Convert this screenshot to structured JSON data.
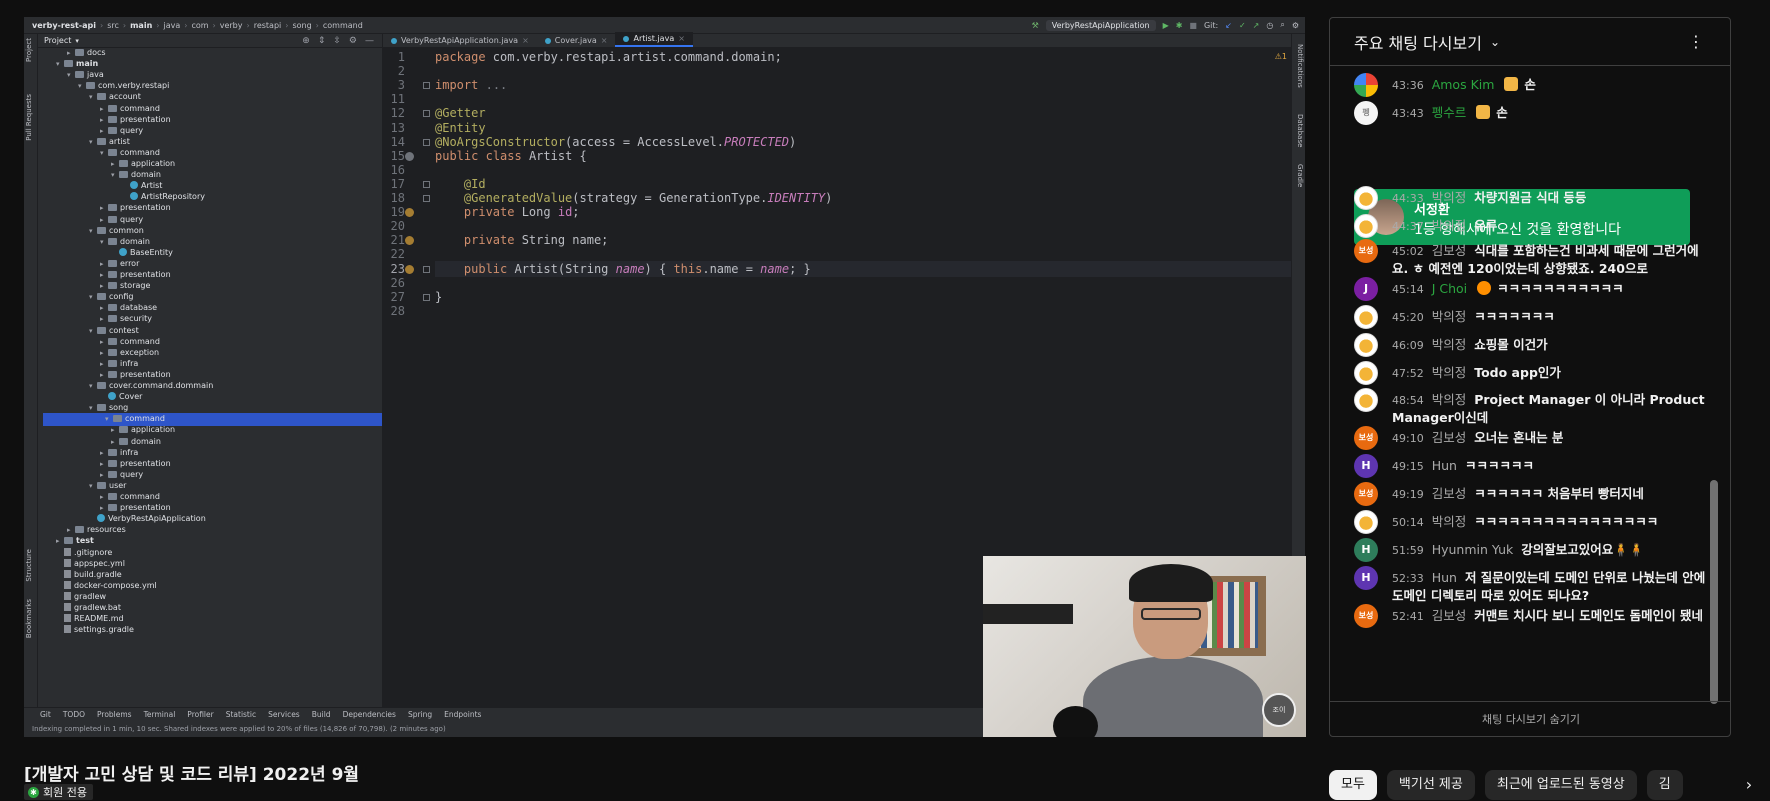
{
  "ide": {
    "breadcrumbs": [
      "verby-rest-api",
      "src",
      "main",
      "java",
      "com",
      "verby",
      "restapi",
      "song",
      "command"
    ],
    "run_config": "VerbyRestApiApplication",
    "git_label": "Git:",
    "project_header": "Project",
    "left_tabs": [
      "Project",
      "Pull Requests",
      "Structure",
      "Bookmarks"
    ],
    "right_tabs": [
      "Notifications",
      "Database",
      "Gradle"
    ],
    "tabs": [
      {
        "label": "VerbyRestApiApplication.java",
        "active": false
      },
      {
        "label": "Cover.java",
        "active": false
      },
      {
        "label": "Artist.java",
        "active": true
      }
    ],
    "tree": [
      {
        "label": "docs",
        "depth": 3,
        "kind": "folder",
        "arrow": "▸"
      },
      {
        "label": "main",
        "depth": 2,
        "kind": "folder",
        "arrow": "▾",
        "bold": true
      },
      {
        "label": "java",
        "depth": 3,
        "kind": "folder",
        "arrow": "▾"
      },
      {
        "label": "com.verby.restapi",
        "depth": 4,
        "kind": "folder",
        "arrow": "▾"
      },
      {
        "label": "account",
        "depth": 5,
        "kind": "folder",
        "arrow": "▾"
      },
      {
        "label": "command",
        "depth": 6,
        "kind": "folder",
        "arrow": "▸"
      },
      {
        "label": "presentation",
        "depth": 6,
        "kind": "folder",
        "arrow": "▸"
      },
      {
        "label": "query",
        "depth": 6,
        "kind": "folder",
        "arrow": "▸"
      },
      {
        "label": "artist",
        "depth": 5,
        "kind": "folder",
        "arrow": "▾"
      },
      {
        "label": "command",
        "depth": 6,
        "kind": "folder",
        "arrow": "▾"
      },
      {
        "label": "application",
        "depth": 7,
        "kind": "folder",
        "arrow": "▸"
      },
      {
        "label": "domain",
        "depth": 7,
        "kind": "folder",
        "arrow": "▾"
      },
      {
        "label": "Artist",
        "depth": 8,
        "kind": "class",
        "arrow": ""
      },
      {
        "label": "ArtistRepository",
        "depth": 8,
        "kind": "class",
        "arrow": ""
      },
      {
        "label": "presentation",
        "depth": 6,
        "kind": "folder",
        "arrow": "▸"
      },
      {
        "label": "query",
        "depth": 6,
        "kind": "folder",
        "arrow": "▸"
      },
      {
        "label": "common",
        "depth": 5,
        "kind": "folder",
        "arrow": "▾"
      },
      {
        "label": "domain",
        "depth": 6,
        "kind": "folder",
        "arrow": "▾"
      },
      {
        "label": "BaseEntity",
        "depth": 7,
        "kind": "class",
        "arrow": ""
      },
      {
        "label": "error",
        "depth": 6,
        "kind": "folder",
        "arrow": "▸"
      },
      {
        "label": "presentation",
        "depth": 6,
        "kind": "folder",
        "arrow": "▸"
      },
      {
        "label": "storage",
        "depth": 6,
        "kind": "folder",
        "arrow": "▸"
      },
      {
        "label": "config",
        "depth": 5,
        "kind": "folder",
        "arrow": "▾"
      },
      {
        "label": "database",
        "depth": 6,
        "kind": "folder",
        "arrow": "▸"
      },
      {
        "label": "security",
        "depth": 6,
        "kind": "folder",
        "arrow": "▸"
      },
      {
        "label": "contest",
        "depth": 5,
        "kind": "folder",
        "arrow": "▾"
      },
      {
        "label": "command",
        "depth": 6,
        "kind": "folder",
        "arrow": "▸"
      },
      {
        "label": "exception",
        "depth": 6,
        "kind": "folder",
        "arrow": "▸"
      },
      {
        "label": "infra",
        "depth": 6,
        "kind": "folder",
        "arrow": "▸"
      },
      {
        "label": "presentation",
        "depth": 6,
        "kind": "folder",
        "arrow": "▸"
      },
      {
        "label": "cover.command.dommain",
        "depth": 5,
        "kind": "folder",
        "arrow": "▾"
      },
      {
        "label": "Cover",
        "depth": 6,
        "kind": "class",
        "arrow": ""
      },
      {
        "label": "song",
        "depth": 5,
        "kind": "folder",
        "arrow": "▾"
      },
      {
        "label": "command",
        "depth": 6,
        "kind": "folder",
        "arrow": "▾",
        "selected": true
      },
      {
        "label": "application",
        "depth": 7,
        "kind": "folder",
        "arrow": "▸"
      },
      {
        "label": "domain",
        "depth": 7,
        "kind": "folder",
        "arrow": "▸"
      },
      {
        "label": "infra",
        "depth": 6,
        "kind": "folder",
        "arrow": "▸"
      },
      {
        "label": "presentation",
        "depth": 6,
        "kind": "folder",
        "arrow": "▸"
      },
      {
        "label": "query",
        "depth": 6,
        "kind": "folder",
        "arrow": "▸"
      },
      {
        "label": "user",
        "depth": 5,
        "kind": "folder",
        "arrow": "▾"
      },
      {
        "label": "command",
        "depth": 6,
        "kind": "folder",
        "arrow": "▸"
      },
      {
        "label": "presentation",
        "depth": 6,
        "kind": "folder",
        "arrow": "▸"
      },
      {
        "label": "VerbyRestApiApplication",
        "depth": 5,
        "kind": "class",
        "arrow": ""
      },
      {
        "label": "resources",
        "depth": 3,
        "kind": "folder",
        "arrow": "▸"
      },
      {
        "label": "test",
        "depth": 2,
        "kind": "folder",
        "arrow": "▸",
        "bold": true
      },
      {
        "label": ".gitignore",
        "depth": 2,
        "kind": "file",
        "arrow": ""
      },
      {
        "label": "appspec.yml",
        "depth": 2,
        "kind": "file",
        "arrow": ""
      },
      {
        "label": "build.gradle",
        "depth": 2,
        "kind": "file",
        "arrow": ""
      },
      {
        "label": "docker-compose.yml",
        "depth": 2,
        "kind": "file",
        "arrow": ""
      },
      {
        "label": "gradlew",
        "depth": 2,
        "kind": "file",
        "arrow": ""
      },
      {
        "label": "gradlew.bat",
        "depth": 2,
        "kind": "file",
        "arrow": ""
      },
      {
        "label": "README.md",
        "depth": 2,
        "kind": "file",
        "arrow": ""
      },
      {
        "label": "settings.gradle",
        "depth": 2,
        "kind": "file",
        "arrow": ""
      }
    ],
    "line_numbers": [
      "1",
      "2",
      "3",
      "11",
      "12",
      "13",
      "14",
      "15",
      "16",
      "17",
      "18",
      "19",
      "20",
      "21",
      "22",
      "23",
      "26",
      "27",
      "28"
    ],
    "code_lines": [
      "package com.verby.restapi.artist.command.domain;",
      "",
      "import ...",
      "",
      "@Getter",
      "@Entity",
      "@NoArgsConstructor(access = AccessLevel.PROTECTED)",
      "public class Artist {",
      "",
      "    @Id",
      "    @GeneratedValue(strategy = GenerationType.IDENTITY)",
      "    private Long id;",
      "",
      "    private String name;",
      "",
      "    public Artist(String name) { this.name = name; }",
      "",
      "}",
      ""
    ],
    "warning_count": "⚠1",
    "bottom_tools": [
      "Git",
      "TODO",
      "Problems",
      "Terminal",
      "Profiler",
      "Statistic",
      "Services",
      "Build",
      "Dependencies",
      "Spring",
      "Endpoints"
    ],
    "status_text": "Indexing completed in 1 min, 10 sec. Shared indexes were applied to 20% of files (14,826 of 70,798). (2 minutes ago)"
  },
  "webcam": {
    "logo_text": "조이"
  },
  "video": {
    "title": "[개발자 고민 상담 및 코드 리뷰] 2022년 9월",
    "members_label": "회원 전용"
  },
  "chat": {
    "title": "주요 채팅 다시보기",
    "footer": "채팅 다시보기 숨기기",
    "welcome": {
      "name": "서정환",
      "text": "1등 항해사에 오신 것을 환영합니다"
    },
    "messages": [
      {
        "time": "43:36",
        "author": "Amos Kim",
        "member": true,
        "badge": "square",
        "text": "손",
        "avatar": "google",
        "avatar_text": ""
      },
      {
        "time": "43:43",
        "author": "펭수르",
        "member": true,
        "badge": "square",
        "text": "손",
        "avatar": "white",
        "avatar_text": "펭"
      },
      {
        "time": "44:33",
        "author": "박의정",
        "member": false,
        "badge": "",
        "text": "차량지원금 식대 등등",
        "avatar": "chicken",
        "avatar_text": ""
      },
      {
        "time": "44:37",
        "author": "박의정",
        "member": false,
        "badge": "",
        "text": "유류",
        "avatar": "chicken",
        "avatar_text": ""
      },
      {
        "time": "45:02",
        "author": "김보성",
        "member": false,
        "badge": "",
        "text": "식대를 포함하는건 비과세 때문에 그런거에요. ㅎ 예전엔 120이었는데 상향됐죠. 240으로",
        "avatar": "orange",
        "avatar_text": "보성"
      },
      {
        "time": "45:14",
        "author": "J Choi",
        "member": true,
        "badge": "round",
        "text": "ㅋㅋㅋㅋㅋㅋㅋㅋㅋㅋㅋ",
        "avatar": "purple2",
        "avatar_text": "J"
      },
      {
        "time": "45:20",
        "author": "박의정",
        "member": false,
        "badge": "",
        "text": "ㅋㅋㅋㅋㅋㅋㅋ",
        "avatar": "chicken",
        "avatar_text": ""
      },
      {
        "time": "46:09",
        "author": "박의정",
        "member": false,
        "badge": "",
        "text": "쇼핑몰 이건가",
        "avatar": "chicken",
        "avatar_text": ""
      },
      {
        "time": "47:52",
        "author": "박의정",
        "member": false,
        "badge": "",
        "text": "Todo app인가",
        "avatar": "chicken",
        "avatar_text": ""
      },
      {
        "time": "48:54",
        "author": "박의정",
        "member": false,
        "badge": "",
        "text": "Project Manager 이 아니라 Product Manager이신데",
        "avatar": "chicken",
        "avatar_text": ""
      },
      {
        "time": "49:10",
        "author": "김보성",
        "member": false,
        "badge": "",
        "text": "오너는 혼내는 분",
        "avatar": "orange",
        "avatar_text": "보성"
      },
      {
        "time": "49:15",
        "author": "Hun",
        "member": false,
        "badge": "",
        "text": "ㅋㅋㅋㅋㅋㅋ",
        "avatar": "purple",
        "avatar_text": "H"
      },
      {
        "time": "49:19",
        "author": "김보성",
        "member": false,
        "badge": "",
        "text": "ㅋㅋㅋㅋㅋㅋ 처음부터 빵터지네",
        "avatar": "orange",
        "avatar_text": "보성"
      },
      {
        "time": "50:14",
        "author": "박의정",
        "member": false,
        "badge": "",
        "text": "ㅋㅋㅋㅋㅋㅋㅋㅋㅋㅋㅋㅋㅋㅋㅋㅋ",
        "avatar": "chicken",
        "avatar_text": ""
      },
      {
        "time": "51:59",
        "author": "Hyunmin Yuk",
        "member": false,
        "badge": "",
        "text": "강의잘보고있어요🧍🧍",
        "avatar": "green",
        "avatar_text": "H"
      },
      {
        "time": "52:33",
        "author": "Hun",
        "member": false,
        "badge": "",
        "text": "저 질문이있는데 도메인 단위로 나눴는데 안에 도메인 디렉토리 따로 있어도 되나요?",
        "avatar": "purple",
        "avatar_text": "H"
      },
      {
        "time": "52:41",
        "author": "김보성",
        "member": false,
        "badge": "",
        "text": "커맨트 치시다 보니 도메인도 돔메인이 됐네",
        "avatar": "orange",
        "avatar_text": "보성"
      }
    ]
  },
  "chips": [
    {
      "label": "모두",
      "active": true
    },
    {
      "label": "백기선 제공",
      "active": false
    },
    {
      "label": "최근에 업로드된 동영상",
      "active": false
    },
    {
      "label": "김",
      "active": false
    }
  ],
  "icons": {
    "chevron": "⌄",
    "kebab": "⋮",
    "next": "›",
    "star": "✱"
  }
}
